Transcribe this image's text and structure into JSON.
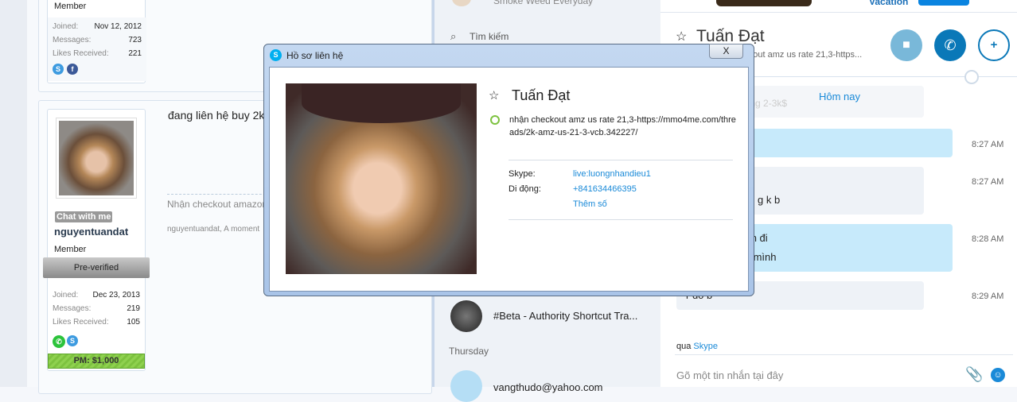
{
  "forum": {
    "user1": {
      "role": "Member",
      "joined_label": "Joined:",
      "joined": "Nov 12, 2012",
      "messages_label": "Messages:",
      "messages": "723",
      "likes_label": "Likes Received:",
      "likes": "221"
    },
    "user2": {
      "chat_badge": "Chat with me",
      "username": "nguyentuandat",
      "role": "Member",
      "banner": "Pre-verified",
      "joined_label": "Joined:",
      "joined": "Dec 23, 2013",
      "messages_label": "Messages:",
      "messages": "219",
      "likes_label": "Likes Received:",
      "likes": "105",
      "pm_badge": "PM: $1,000"
    },
    "post_title": "đang liên hệ buy 2k$",
    "signature": "Nhận checkout amazon",
    "footer": "nguyentuandat, A moment"
  },
  "contacts": {
    "top_item": "Smoke Weed Everyday",
    "search_placeholder": "Tìm kiếm",
    "items": [
      {
        "name": "#Beta - Authority Shortcut Tra..."
      }
    ],
    "section": "Thursday",
    "partial_item": "vangthudo@yahoo.com"
  },
  "chat": {
    "banner_text": "Vacation",
    "contact_name": "Tuấn Đạt",
    "mood": "nhận checkout amz us rate 21,3-https...",
    "date_divider": "Hôm nay",
    "messages": [
      {
        "text": "bảng 2-3k$",
        "time": ""
      },
      {
        "text": "😁",
        "time": "8:27 AM"
      },
      {
        "text": "g k b",
        "time": "8:27 AM"
      },
      {
        "text": "nhận đi",
        "text2": "của mình",
        "time": "8:28 AM"
      },
      {
        "text": "r đó b",
        "time": "8:29 AM"
      }
    ],
    "via_prefix": "qua",
    "via_link": "Skype",
    "input_placeholder": "Gõ một tin nhắn tại đây"
  },
  "dialog": {
    "title": "Hồ sơ liên hệ",
    "close_label": "X",
    "name": "Tuấn Đạt",
    "mood": "nhận checkout amz us rate 21,3-https://mmo4me.com/threads/2k-amz-us-21-3-vcb.342227/",
    "skype_label": "Skype:",
    "skype_value": "live:luongnhandieu1",
    "mobile_label": "Di động:",
    "mobile_value": "+841634466395",
    "add_number": "Thêm số"
  },
  "colors": {
    "skype_blue": "#0078d7",
    "link": "#1a8ad8",
    "bubble_out": "#c7eafb",
    "bubble_in": "#eef2f7"
  }
}
